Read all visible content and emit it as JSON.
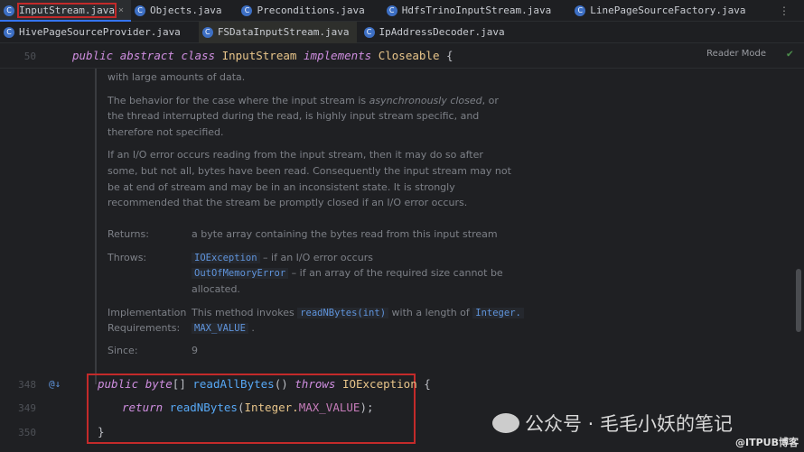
{
  "tabs_row1": [
    {
      "label": "InputStream.java",
      "active": true
    },
    {
      "label": "Objects.java"
    },
    {
      "label": "Preconditions.java"
    },
    {
      "label": "HdfsTrinoInputStream.java"
    },
    {
      "label": "LinePageSourceFactory.java"
    }
  ],
  "tabs_row2": [
    {
      "label": "HivePageSourceProvider.java"
    },
    {
      "label": "FSDataInputStream.java"
    },
    {
      "label": "IpAddressDecoder.java"
    }
  ],
  "tab_icon": "C",
  "more_icon": "⋮",
  "close_icon": "×",
  "editor": {
    "reader_mode": "Reader Mode",
    "header_line": {
      "num": "50",
      "public": "public",
      "abstract": "abstract",
      "class": "class",
      "name": "InputStream",
      "implements": "implements",
      "iface": "Closeable",
      "brace": "{"
    },
    "doc": {
      "p0": "with large amounts of data.",
      "p1a": "The behavior for the case where the input stream is ",
      "p1i": "asynchronously closed",
      "p1b": ", or",
      "p1c": "the thread interrupted during the read, is highly input stream specific, and",
      "p1d": "therefore not specified.",
      "p2a": "If an I/O error occurs reading from the input stream, then it may do so after",
      "p2b": "some, but not all, bytes have been read. Consequently the input stream may not",
      "p2c": "be at end of stream and may be in an inconsistent state. It is strongly",
      "p2d": "recommended that the stream be promptly closed if an I/O error occurs.",
      "returns_label": "Returns:",
      "returns_value": "a byte array containing the bytes read from this input stream",
      "throws_label": "Throws:",
      "throws1_link": "IOException",
      "throws1_text": " – if an I/O error occurs",
      "throws2_link": "OutOfMemoryError",
      "throws2_text": " – if an array of the required size cannot be",
      "throws2_cont": "allocated.",
      "impl_label1": "Implementation",
      "impl_label2": "Requirements:",
      "impl_text1": "This method invokes ",
      "impl_link1": "readNBytes(int)",
      "impl_text2": " with a length of ",
      "impl_link2": "Integer.",
      "impl_link3": "MAX_VALUE",
      "impl_text3": " .",
      "since_label": "Since:",
      "since_value": "9"
    },
    "lines": [
      {
        "num": "348"
      },
      {
        "num": "349"
      },
      {
        "num": "350"
      }
    ],
    "code": {
      "public": "public",
      "byte": "byte",
      "arr": "[] ",
      "method": "readAllBytes",
      "paren": "() ",
      "throws": "throws",
      "exc": " IOException",
      "brace": " {",
      "return": "return",
      "call": " readNBytes",
      "open": "(",
      "integer": "Integer.",
      "maxv": "MAX_VALUE",
      "close": ");",
      "end": "}"
    },
    "gutter_icon": "@↓"
  },
  "watermark": {
    "text": "公众号 · 毛毛小妖的笔记",
    "site": "@ITPUB博客"
  }
}
